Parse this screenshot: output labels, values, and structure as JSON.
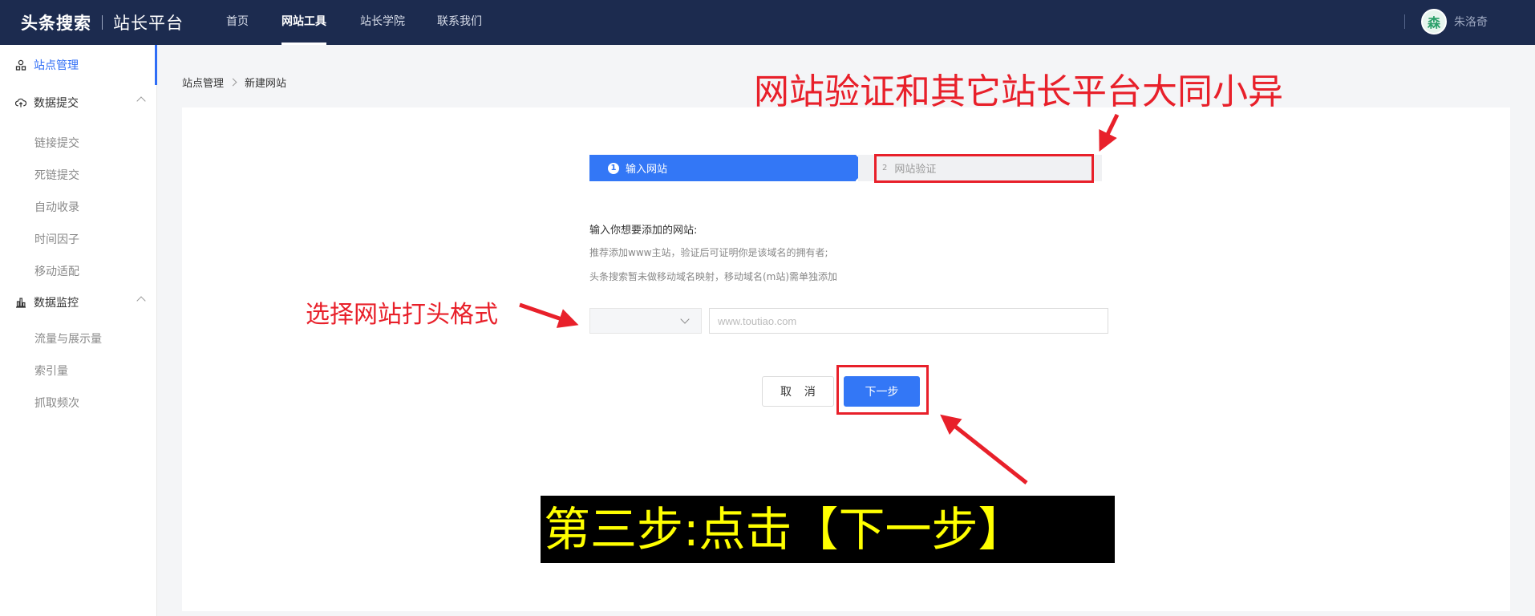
{
  "topbar": {
    "brand_main": "头条搜索",
    "brand_sub": "站长平台",
    "nav": [
      "首页",
      "网站工具",
      "站长学院",
      "联系我们"
    ],
    "active_nav": "网站工具",
    "avatar_glyph": "森",
    "username": "朱洛奇"
  },
  "sidebar": {
    "site_manage": "站点管理",
    "data_submit": "数据提交",
    "submit_items": [
      "链接提交",
      "死链提交",
      "自动收录",
      "时间因子",
      "移动适配"
    ],
    "data_monitor": "数据监控",
    "monitor_items": [
      "流量与展示量",
      "索引量",
      "抓取频次"
    ]
  },
  "breadcrumb": [
    "站点管理",
    "新建网站"
  ],
  "steps": {
    "step1_num": "1",
    "step1_label": "输入网站",
    "step2_num": "2",
    "step2_label": "网站验证"
  },
  "form": {
    "label": "输入你想要添加的网站:",
    "hint1": "推荐添加www主站，验证后可证明你是该域名的拥有者;",
    "hint2": "头条搜索暂未做移动域名映射，移动域名(m站)需单独添加",
    "select_value": "",
    "input_value": "",
    "input_placeholder": "www.toutiao.com",
    "cancel_label": "取 消",
    "next_label": "下一步"
  },
  "annotations": {
    "title": "网站验证和其它站长平台大同小异",
    "left_note": "选择网站打头格式",
    "banner": "第三步:点击【下一步】",
    "color": "#e8202a",
    "banner_color": "#ffff00"
  },
  "colors": {
    "topbar": "#1c2b4f",
    "primary": "#3377f6"
  }
}
